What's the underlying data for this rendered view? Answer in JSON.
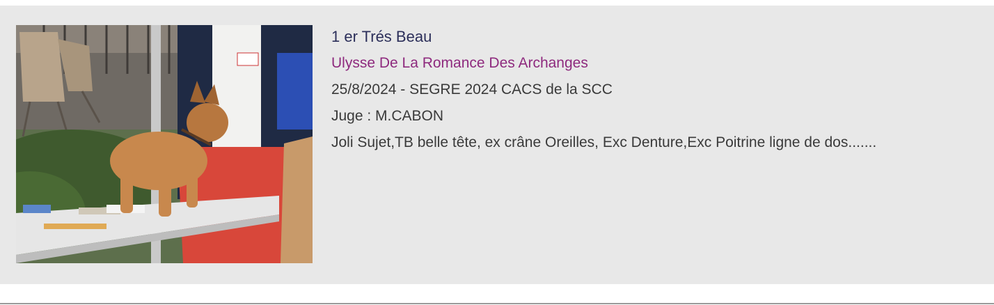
{
  "result": {
    "rank": "1 er Trés Beau",
    "dog_name": "Ulysse De La Romance Des Archanges",
    "event": "25/8/2024 - SEGRE 2024 CACS de la SCC",
    "judge": "Juge : M.CABON",
    "comment": "Joli Sujet,TB belle tête, ex crâne Oreilles, Exc Denture,Exc Poitrine ligne de dos......."
  },
  "colors": {
    "card_background": "#e8e8e8",
    "rank_text": "#2c2f5a",
    "dog_name_link": "#8e2a7e",
    "body_text": "#3a3a3a"
  }
}
